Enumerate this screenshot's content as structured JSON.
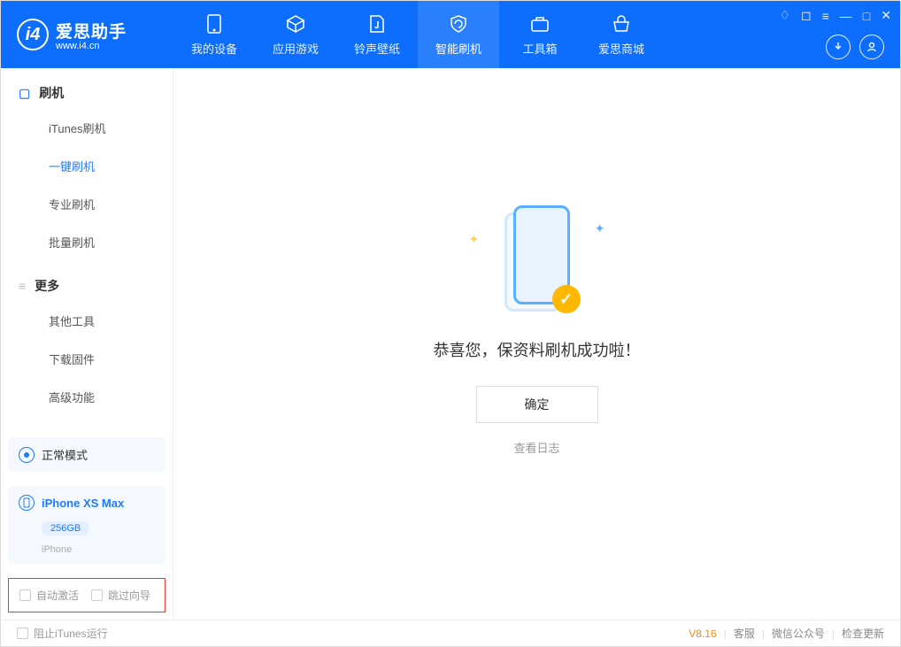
{
  "app": {
    "title": "爱思助手",
    "url": "www.i4.cn"
  },
  "nav": [
    {
      "label": "我的设备"
    },
    {
      "label": "应用游戏"
    },
    {
      "label": "铃声壁纸"
    },
    {
      "label": "智能刷机"
    },
    {
      "label": "工具箱"
    },
    {
      "label": "爱思商城"
    }
  ],
  "sidebar": {
    "group1": {
      "title": "刷机",
      "items": [
        {
          "label": "iTunes刷机"
        },
        {
          "label": "一键刷机"
        },
        {
          "label": "专业刷机"
        },
        {
          "label": "批量刷机"
        }
      ]
    },
    "group2": {
      "title": "更多",
      "items": [
        {
          "label": "其他工具"
        },
        {
          "label": "下载固件"
        },
        {
          "label": "高级功能"
        }
      ]
    }
  },
  "device_mode": {
    "label": "正常模式"
  },
  "device_info": {
    "name": "iPhone XS Max",
    "storage": "256GB",
    "type": "iPhone"
  },
  "options": {
    "auto_activate": "自动激活",
    "skip_guide": "跳过向导"
  },
  "main": {
    "success_msg": "恭喜您，保资料刷机成功啦！",
    "ok_button": "确定",
    "view_log": "查看日志"
  },
  "footer": {
    "block_itunes": "阻止iTunes运行",
    "version": "V8.16",
    "service": "客服",
    "wechat": "微信公众号",
    "update": "检查更新"
  }
}
